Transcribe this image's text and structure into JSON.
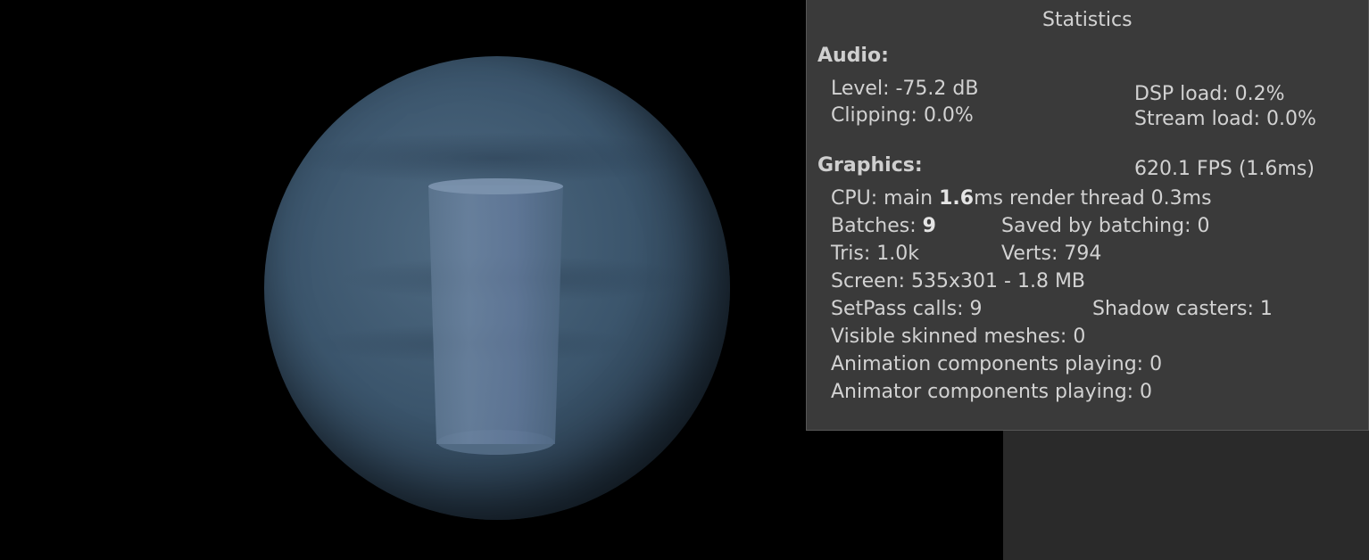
{
  "stats": {
    "title": "Statistics",
    "audio": {
      "header": "Audio:",
      "level": "Level: -75.2 dB",
      "clipping": "Clipping: 0.0%",
      "dsp_load": "DSP load: 0.2%",
      "stream_load": "Stream load: 0.0%"
    },
    "graphics": {
      "header": "Graphics:",
      "fps": "620.1 FPS (1.6ms)",
      "cpu_prefix": "CPU: main ",
      "cpu_main_value": "1.6",
      "cpu_suffix": "ms  render thread 0.3ms",
      "batches_label": "Batches: ",
      "batches_value": "9",
      "saved_by_batching": "Saved by batching: 0",
      "tris": "Tris: 1.0k",
      "verts": "Verts: 794",
      "screen": "Screen: 535x301 - 1.8 MB",
      "setpass_calls": "SetPass calls: 9",
      "shadow_casters": "Shadow casters: 1",
      "visible_skinned_meshes": "Visible skinned meshes: 0",
      "animation_components": "Animation components playing: 0",
      "animator_components": "Animator components playing: 0"
    }
  }
}
